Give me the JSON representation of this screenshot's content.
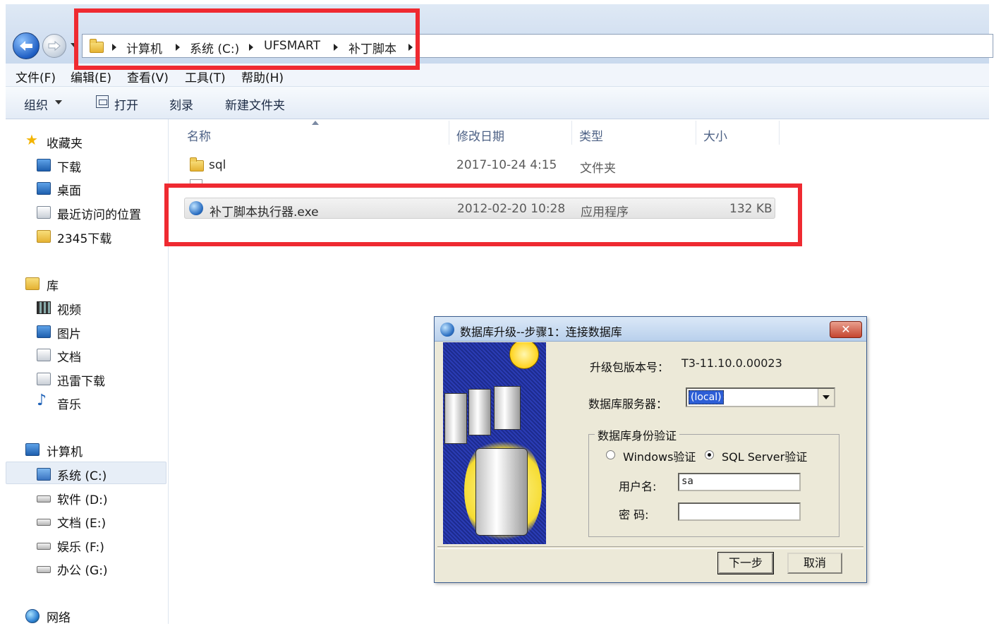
{
  "breadcrumb": {
    "items": [
      "计算机",
      "系统 (C:)",
      "UFSMART",
      "补丁脚本"
    ]
  },
  "menu": {
    "items": [
      "文件(F)",
      "编辑(E)",
      "查看(V)",
      "工具(T)",
      "帮助(H)"
    ]
  },
  "toolbar": {
    "organize": "组织",
    "open": "打开",
    "burn": "刻录",
    "new_folder": "新建文件夹"
  },
  "sidebar": {
    "favorites": {
      "header": "收藏夹",
      "items": [
        "下载",
        "桌面",
        "最近访问的位置",
        "2345下载"
      ]
    },
    "libraries": {
      "header": "库",
      "items": [
        "视频",
        "图片",
        "文档",
        "迅雷下载",
        "音乐"
      ]
    },
    "computer": {
      "header": "计算机",
      "items": [
        "系统 (C:)",
        "软件 (D:)",
        "文档 (E:)",
        "娱乐 (F:)",
        "办公 (G:)"
      ]
    },
    "network": {
      "header": "网络"
    }
  },
  "filelist": {
    "columns": [
      "名称",
      "修改日期",
      "类型",
      "大小"
    ],
    "rows": [
      {
        "name": "sql",
        "date": "2017-10-24 4:15",
        "type": "文件夹",
        "size": ""
      },
      {
        "name": "补丁脚本执行器.exe",
        "date": "2012-02-20 10:28",
        "type": "应用程序",
        "size": "132 KB"
      }
    ]
  },
  "dialog": {
    "title": "数据库升级--步骤1：连接数据库",
    "close": "✕",
    "version_label": "升级包版本号：",
    "version_value": "T3-11.10.0.00023",
    "server_label": "数据库服务器：",
    "server_value": "(local)",
    "auth_group": "数据库身份验证",
    "auth_windows": "Windows验证",
    "auth_sql": "SQL Server验证",
    "username_label": "用户名:",
    "username_value": "sa",
    "password_label": "密  码:",
    "password_value": "",
    "next": "下一步",
    "cancel": "取消"
  },
  "colors": {
    "annotation": "#ef2a31",
    "accent": "#2d5ed6"
  }
}
